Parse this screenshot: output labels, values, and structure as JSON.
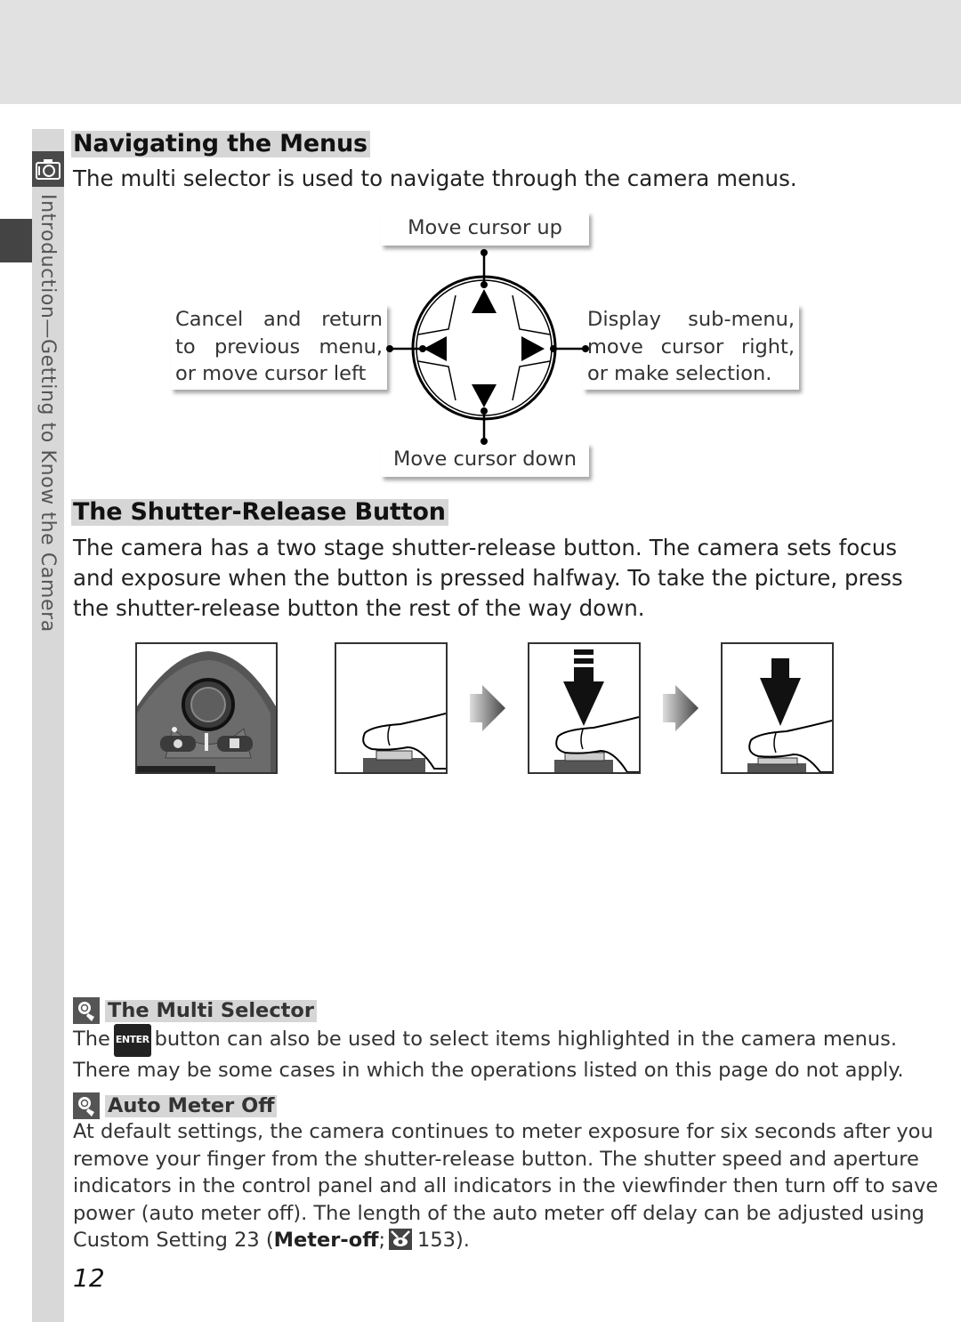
{
  "sidebar": {
    "tab_icon": "camera-icon",
    "chapter_label": "Introduction—Getting to Know the Camera"
  },
  "section1": {
    "heading": "Navigating the Menus",
    "intro": "The multi selector is used to navigate through the camera menus.",
    "diagram": {
      "center_icon": "multi-selector-icon",
      "up_label": "Move cursor up",
      "down_label": "Move cursor down",
      "left_label_lines": [
        "Cancel and return",
        "to previous menu,",
        "or move cursor left"
      ],
      "right_label_lines": [
        "Display sub-menu,",
        "move cursor right,",
        "or make selection."
      ]
    }
  },
  "section2": {
    "heading": "The Shutter-Release Button",
    "body_lines": [
      "The camera has a two stage shutter-release button.  The camera sets focus",
      "and exposure when the button is pressed halfway.  To take the picture, press",
      "the shutter-release button the rest of the way down."
    ],
    "illustrations": [
      {
        "name": "camera-top-view",
        "icon": "camera-body-icon"
      },
      {
        "name": "finger-on-button",
        "icon": "finger-icon"
      },
      {
        "name": "press-halfway",
        "icon": "half-press-arrow-icon"
      },
      {
        "name": "press-fully",
        "icon": "full-press-arrow-icon"
      }
    ]
  },
  "notes": [
    {
      "icon": "note-magnifier-icon",
      "title": "The Multi Selector",
      "line1_prefix": "The",
      "line1_key": "ENTER",
      "line1_suffix": "button can also be used to select items highlighted in the camera menus.",
      "line2": "There may be some cases in which the operations listed on this page do not apply."
    },
    {
      "icon": "note-magnifier-icon",
      "title": "Auto Meter Off",
      "lines": [
        "At default settings, the camera continues to meter exposure for six seconds after you",
        "remove your finger from the shutter-release button.  The shutter speed and aperture",
        "indicators in the control panel and all indicators in the viewfinder then turn off to save",
        "power (auto meter off).  The length of the auto meter off delay can be adjusted using"
      ],
      "last_prefix": "Custom Setting 23 (",
      "last_bold": "Meter-off",
      "last_sep": ";",
      "last_ref_icon": "page-reference-icon",
      "last_page": "153",
      "last_suffix": ")."
    }
  ],
  "footer": {
    "page_number": "12"
  }
}
